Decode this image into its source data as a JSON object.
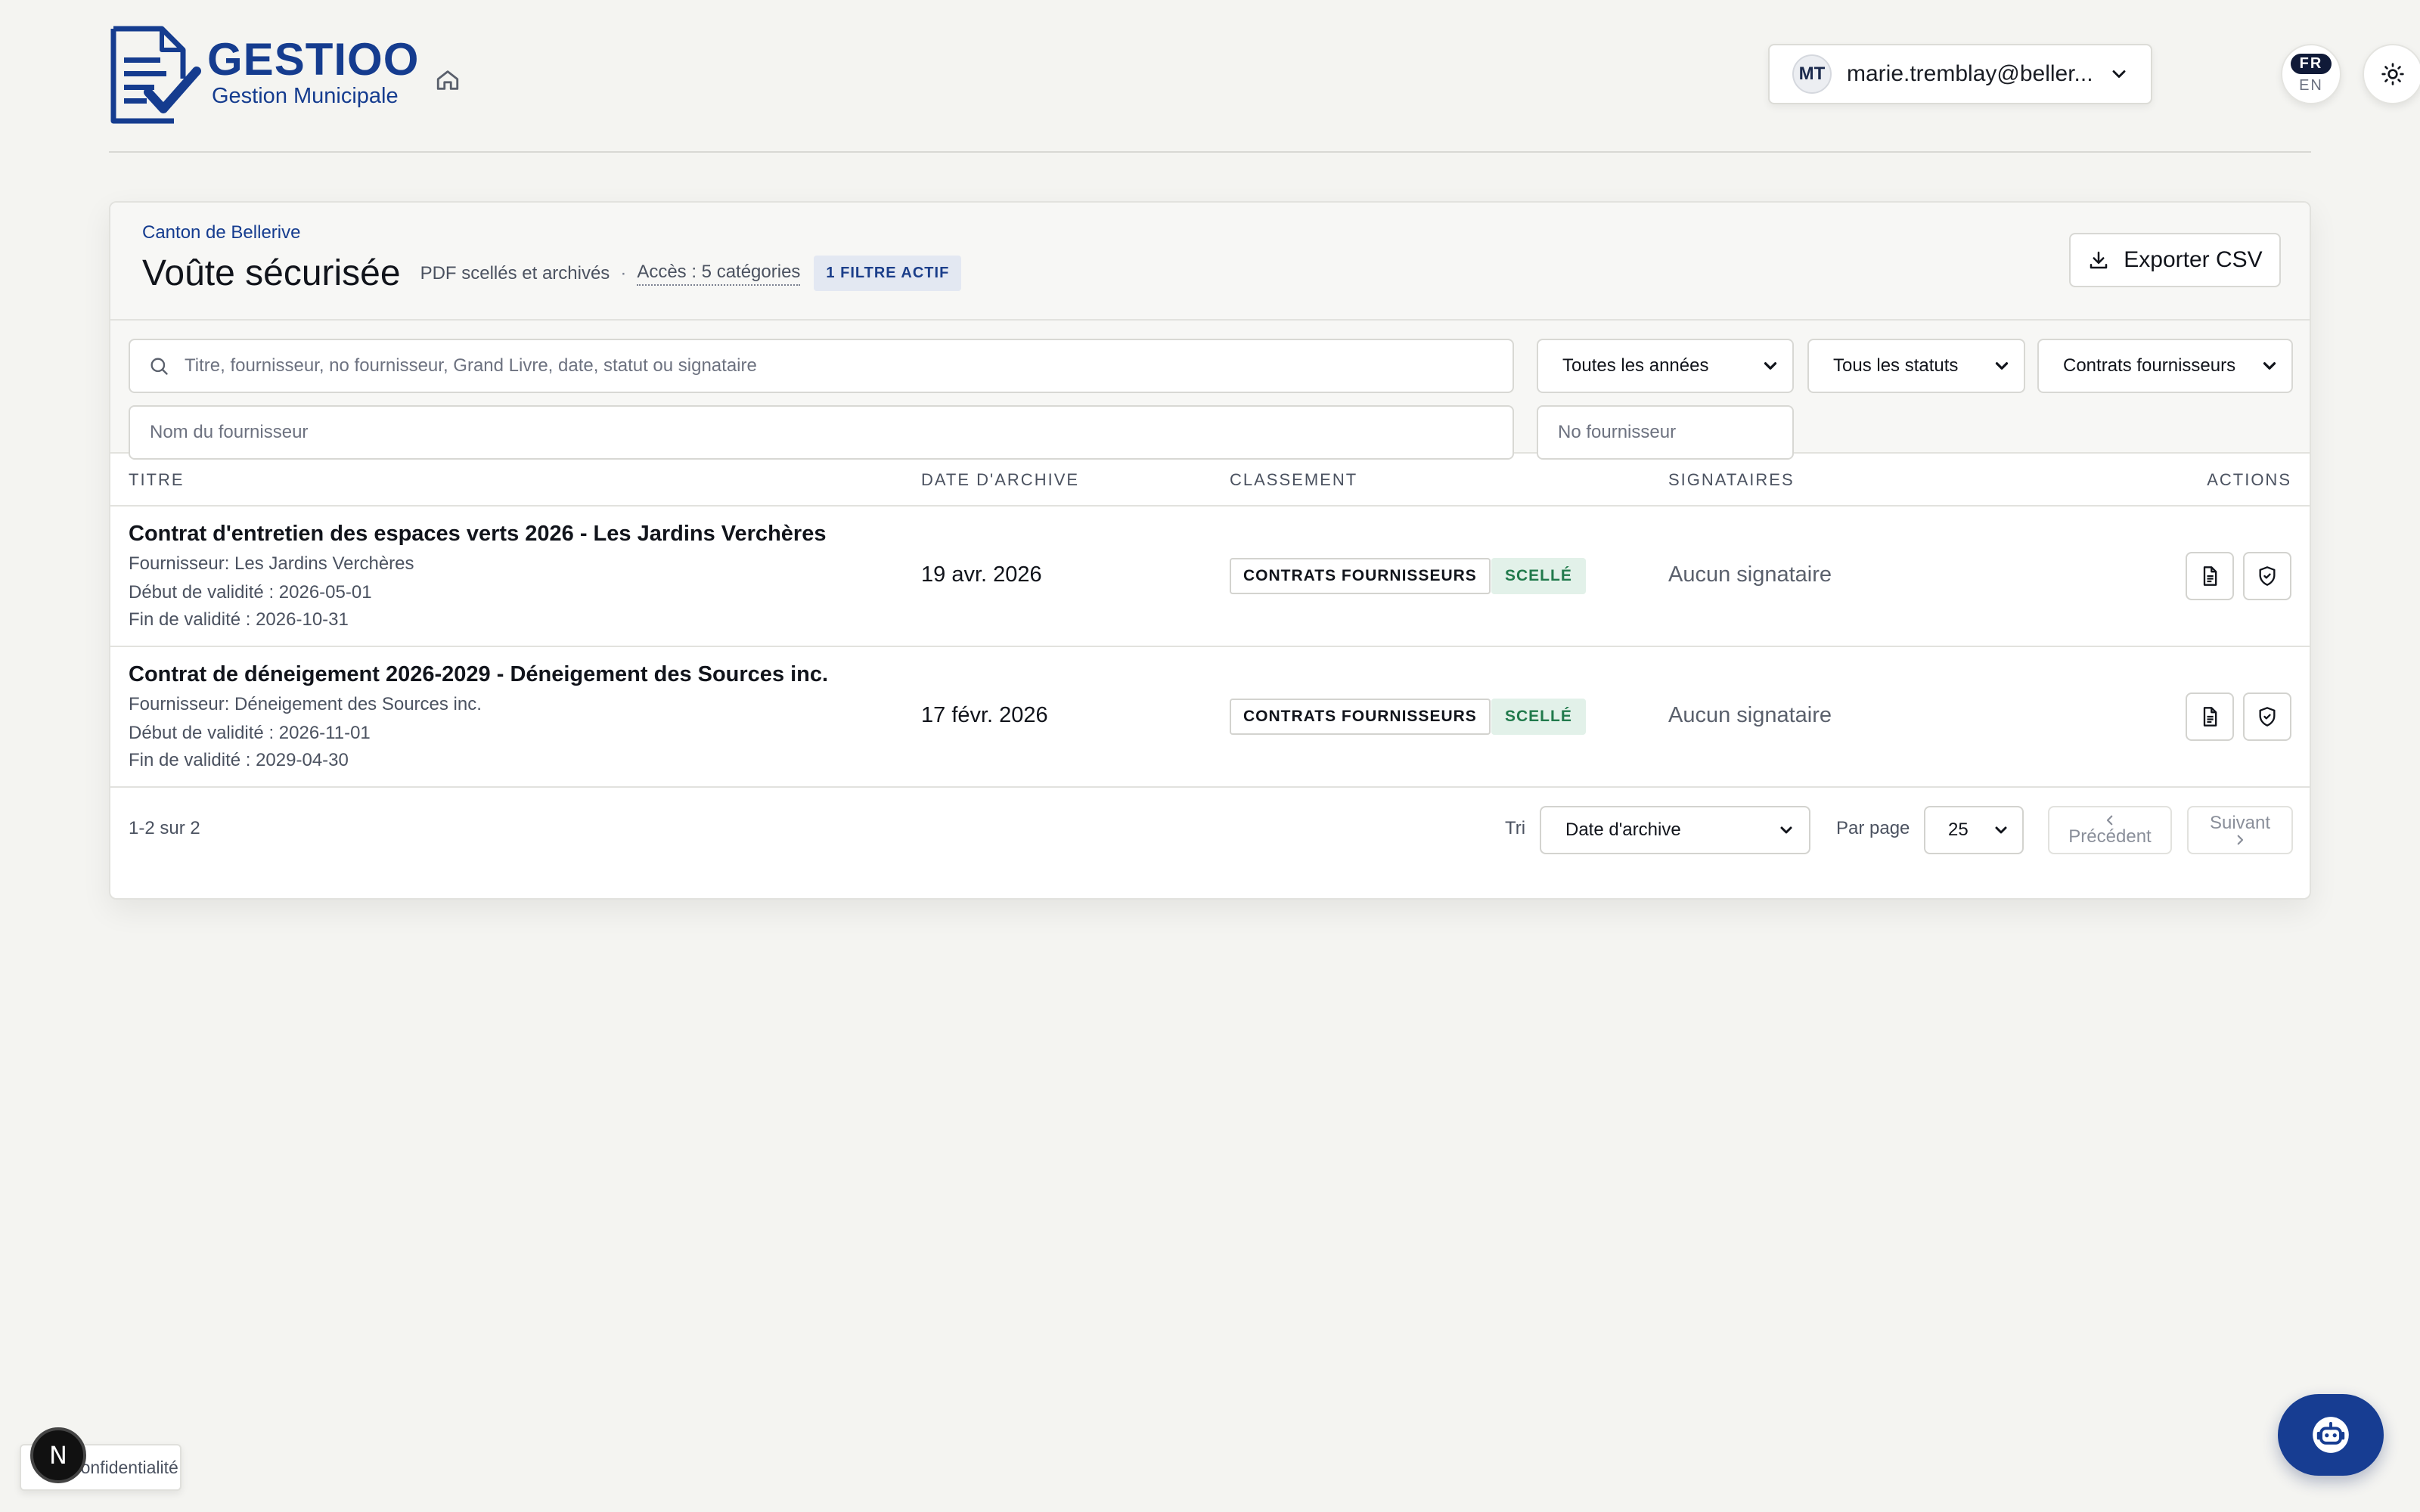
{
  "brand": {
    "name": "GESTIOO",
    "subtitle": "Gestion Municipale"
  },
  "header": {
    "user_initials": "MT",
    "user_email": "marie.tremblay@beller...",
    "lang_active": "FR",
    "lang_other": "EN"
  },
  "vault": {
    "organization": "Canton de Bellerive",
    "title": "Voûte sécurisée",
    "subtitle": "PDF scellés et archivés",
    "separator": "·",
    "access": "Accès : 5 catégories",
    "filter_badge": "1 FILTRE ACTIF",
    "export_label": "Exporter CSV"
  },
  "filters": {
    "search_placeholder": "Titre, fournisseur, no fournisseur, Grand Livre, date, statut ou signataire",
    "year_select": "Toutes les années",
    "status_select": "Tous les statuts",
    "category_select": "Contrats fournisseurs",
    "supplier_name_placeholder": "Nom du fournisseur",
    "supplier_number_placeholder": "No fournisseur"
  },
  "table": {
    "columns": [
      "TITRE",
      "DATE D'ARCHIVE",
      "CLASSEMENT",
      "SIGNATAIRES",
      "ACTIONS"
    ],
    "rows": [
      {
        "title": "Contrat d'entretien des espaces verts 2026 - Les Jardins Verchères",
        "supplier": "Fournisseur: Les Jardins Verchères",
        "start": "Début de validité : 2026-05-01",
        "end": "Fin de validité : 2026-10-31",
        "archive_date": "19 avr. 2026",
        "category": "CONTRATS FOURNISSEURS",
        "status": "SCELLÉ",
        "signers": "Aucun signataire"
      },
      {
        "title": "Contrat de déneigement 2026-2029 - Déneigement des Sources inc.",
        "supplier": "Fournisseur: Déneigement des Sources inc.",
        "start": "Début de validité : 2026-11-01",
        "end": "Fin de validité : 2029-04-30",
        "archive_date": "17 févr. 2026",
        "category": "CONTRATS FOURNISSEURS",
        "status": "SCELLÉ",
        "signers": "Aucun signataire"
      }
    ]
  },
  "pagination": {
    "count": "1-2 sur 2",
    "sort_label": "Tri",
    "sort_value": "Date d'archive",
    "per_page_label": "Par page",
    "per_page_value": "25",
    "prev_label": "Précédent",
    "next_label": "Suivant"
  },
  "footer": {
    "privacy_label": "Confidentialité",
    "dev_badge": "N"
  },
  "colors": {
    "brand": "#153c8f",
    "background": "#f4f4f1",
    "sealed_bg": "#e2f1e9",
    "sealed_text": "#217a4c"
  },
  "icons": [
    "document-check-icon",
    "home-icon",
    "chevron-down-icon",
    "sun-icon",
    "download-icon",
    "search-icon",
    "file-icon",
    "shield-check-icon",
    "chevron-left-icon",
    "chevron-right-icon",
    "robot-icon"
  ]
}
